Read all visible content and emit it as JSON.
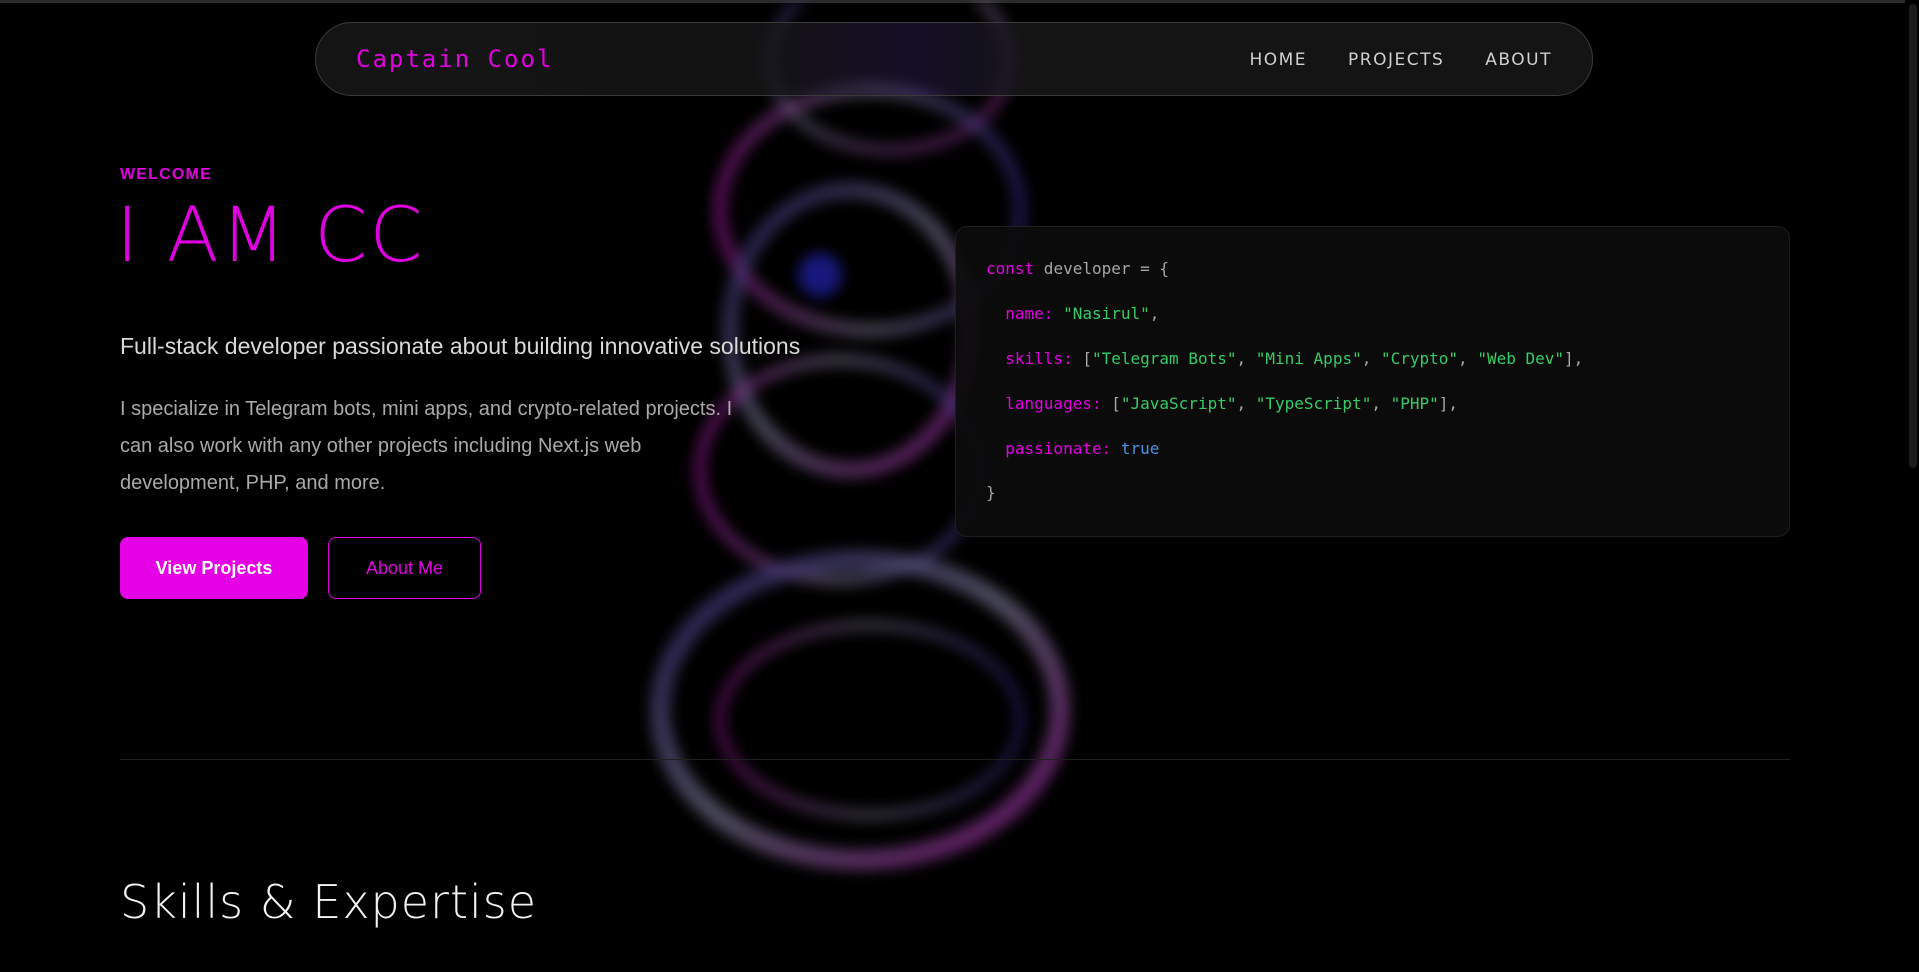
{
  "nav": {
    "brand": "Captain Cool",
    "links": [
      "HOME",
      "PROJECTS",
      "ABOUT"
    ]
  },
  "hero": {
    "eyebrow": "WELCOME",
    "title": "I AM CC",
    "subtitle": "Full-stack developer passionate about building innovative solutions",
    "description": "I specialize in Telegram bots, mini apps, and crypto-related projects. I can also work with any other projects including Next.js web development, PHP, and more.",
    "primary_button": "View Projects",
    "secondary_button": "About Me"
  },
  "code": {
    "decl_keyword": "const",
    "decl_rest": " developer = {",
    "name_key": "name:",
    "name_value": "\"Nasirul\"",
    "skills_key": "skills:",
    "skills": [
      "\"Telegram Bots\"",
      "\"Mini Apps\"",
      "\"Crypto\"",
      "\"Web Dev\""
    ],
    "languages_key": "languages:",
    "languages": [
      "\"JavaScript\"",
      "\"TypeScript\"",
      "\"PHP\""
    ],
    "passionate_key": "passionate:",
    "passionate_value": "true",
    "closing": "}"
  },
  "skills_section": {
    "title": "Skills & Expertise"
  },
  "colors": {
    "accent": "#e100e1",
    "background": "#000000",
    "string": "#33cc66",
    "boolean": "#4a90e8"
  }
}
